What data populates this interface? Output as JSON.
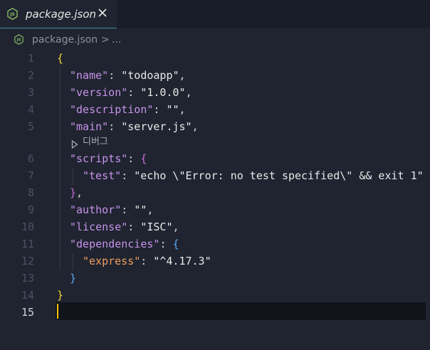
{
  "tab": {
    "label": "package.json",
    "icon": "js-icon",
    "close_icon": "close-icon"
  },
  "breadcrumb": {
    "file": "package.json",
    "separator": ">",
    "more": "..."
  },
  "codelens": {
    "label": "디버그",
    "icon": "play-icon"
  },
  "lines": [
    {
      "number": "1",
      "text": "{"
    },
    {
      "number": "2",
      "text": "\"name\": \"todoapp\","
    },
    {
      "number": "3",
      "text": "\"version\": \"1.0.0\","
    },
    {
      "number": "4",
      "text": "\"description\": \"\","
    },
    {
      "number": "5",
      "text": "\"main\": \"server.js\","
    },
    {
      "number": "6",
      "text": "\"scripts\": {"
    },
    {
      "number": "7",
      "text": "\"test\": \"echo \\\"Error: no test specified\\\" && exit 1\""
    },
    {
      "number": "8",
      "text": "},"
    },
    {
      "number": "9",
      "text": "\"author\": \"\","
    },
    {
      "number": "10",
      "text": "\"license\": \"ISC\","
    },
    {
      "number": "11",
      "text": "\"dependencies\": {"
    },
    {
      "number": "12",
      "text": "\"express\": \"^4.17.3\""
    },
    {
      "number": "13",
      "text": "}"
    },
    {
      "number": "14",
      "text": "}"
    },
    {
      "number": "15",
      "text": ""
    }
  ],
  "tokens": {
    "l1_brace": "{",
    "l2_key": "\"name\"",
    "l2_colon": ": ",
    "l2_val": "\"todoapp\"",
    "l2_comma": ",",
    "l3_key": "\"version\"",
    "l3_colon": ": ",
    "l3_val": "\"1.0.0\"",
    "l3_comma": ",",
    "l4_key": "\"description\"",
    "l4_colon": ": ",
    "l4_val": "\"\"",
    "l4_comma": ",",
    "l5_key": "\"main\"",
    "l5_colon": ": ",
    "l5_val": "\"server.js\"",
    "l5_comma": ",",
    "l6_key": "\"scripts\"",
    "l6_colon": ": ",
    "l6_brace": "{",
    "l7_key": "\"test\"",
    "l7_colon": ": ",
    "l7_val": "\"echo \\\"Error: no test specified\\\" && exit 1\"",
    "l8_brace": "}",
    "l8_comma": ",",
    "l9_key": "\"author\"",
    "l9_colon": ": ",
    "l9_val": "\"\"",
    "l9_comma": ",",
    "l10_key": "\"license\"",
    "l10_colon": ": ",
    "l10_val": "\"ISC\"",
    "l10_comma": ",",
    "l11_key": "\"dependencies\"",
    "l11_colon": ": ",
    "l11_brace": "{",
    "l12_key": "\"express\"",
    "l12_colon": ": ",
    "l12_val": "\"^4.17.3\"",
    "l13_brace": "}",
    "l14_brace": "}"
  },
  "active_line": "15",
  "colors": {
    "background": "#1f2430",
    "keyword": "#c792ea",
    "key_nested": "#f29d5b",
    "cursor": "#f0c20a"
  }
}
